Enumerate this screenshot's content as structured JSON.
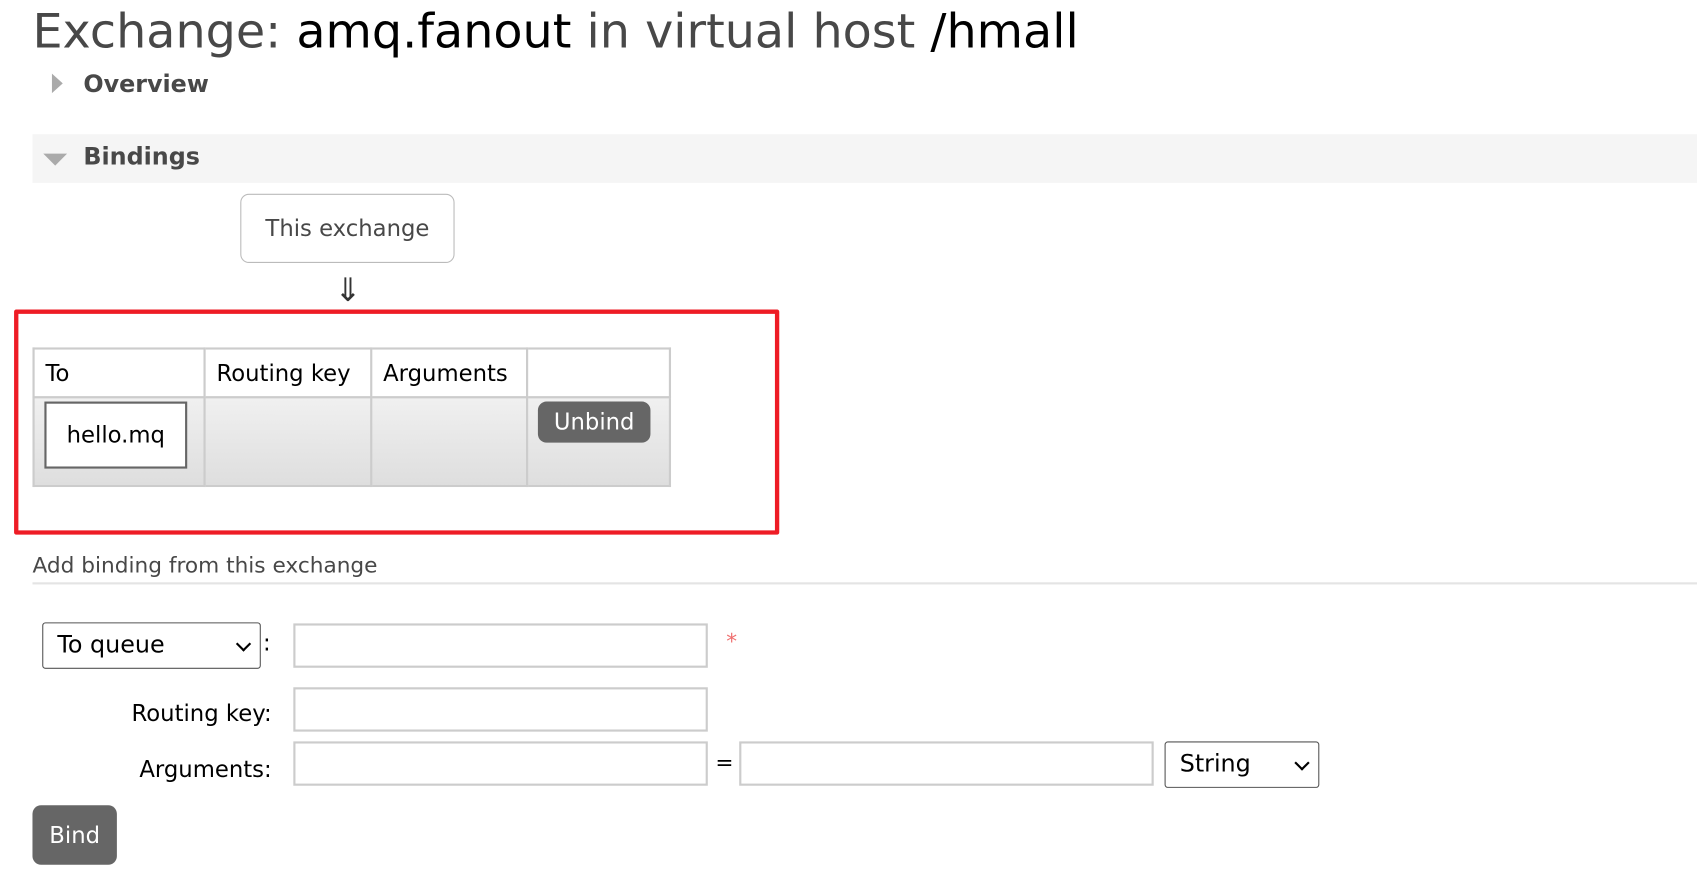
{
  "title": {
    "prefix": "Exchange: ",
    "exchange": "amq.fanout",
    "middle": " in virtual host ",
    "vhost": "/hmall"
  },
  "sections": {
    "overview": "Overview",
    "bindings": "Bindings"
  },
  "diagram": {
    "source": "This exchange",
    "arrow": "⇓"
  },
  "bindings_table": {
    "headers": [
      "To",
      "Routing key",
      "Arguments",
      ""
    ],
    "rows": [
      {
        "to": "hello.mq",
        "routing_key": "",
        "arguments": "",
        "action": "Unbind"
      }
    ]
  },
  "add_binding": {
    "heading": "Add binding from this exchange",
    "destination_type": "To queue",
    "colon": ":",
    "required_mark": "*",
    "routing_key_label": "Routing key:",
    "arguments_label": "Arguments:",
    "equals": "=",
    "argument_type": "String",
    "bind_label": "Bind"
  },
  "colors": {
    "highlight": "#ee1c25",
    "button": "#666666"
  }
}
